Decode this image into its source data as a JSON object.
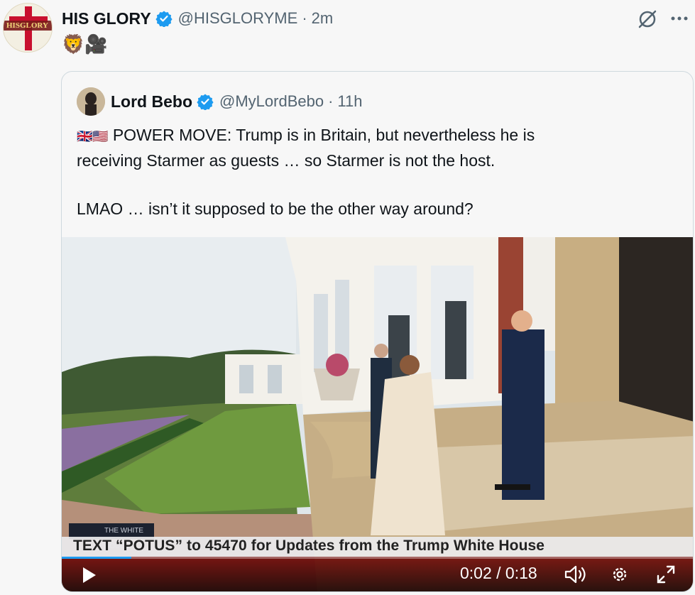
{
  "post": {
    "author_name": "HIS GLORY",
    "author_handle": "@HISGLORYME",
    "separator": "·",
    "time": "2m",
    "avatar_text": "HISGLORY",
    "text": "🦁🎥"
  },
  "quoted": {
    "author_name": "Lord Bebo",
    "author_handle": "@MyLordBebo",
    "separator": "·",
    "time": "11h",
    "flags": "🇬🇧🇺🇸",
    "line1": "POWER MOVE: Trump is in Britain, but nevertheless he is",
    "line2": "receiving Starmer as guests … so Starmer is not the host.",
    "line3": "LMAO … isn’t it supposed to be the other way around?"
  },
  "video": {
    "lower_third": "THE WHITE HOUSE",
    "ticker": "TEXT “POTUS” to 45470 for Updates from the Trump White House",
    "time_display": "0:02 / 0:18",
    "progress": 0.11,
    "icons": [
      "play-icon",
      "volume-icon",
      "settings-gear-icon",
      "fullscreen-icon"
    ]
  },
  "colors": {
    "verified": "#1d9bf0",
    "muted_text": "#536471",
    "border": "#cfd9de",
    "control_bar": "#6e0000"
  }
}
